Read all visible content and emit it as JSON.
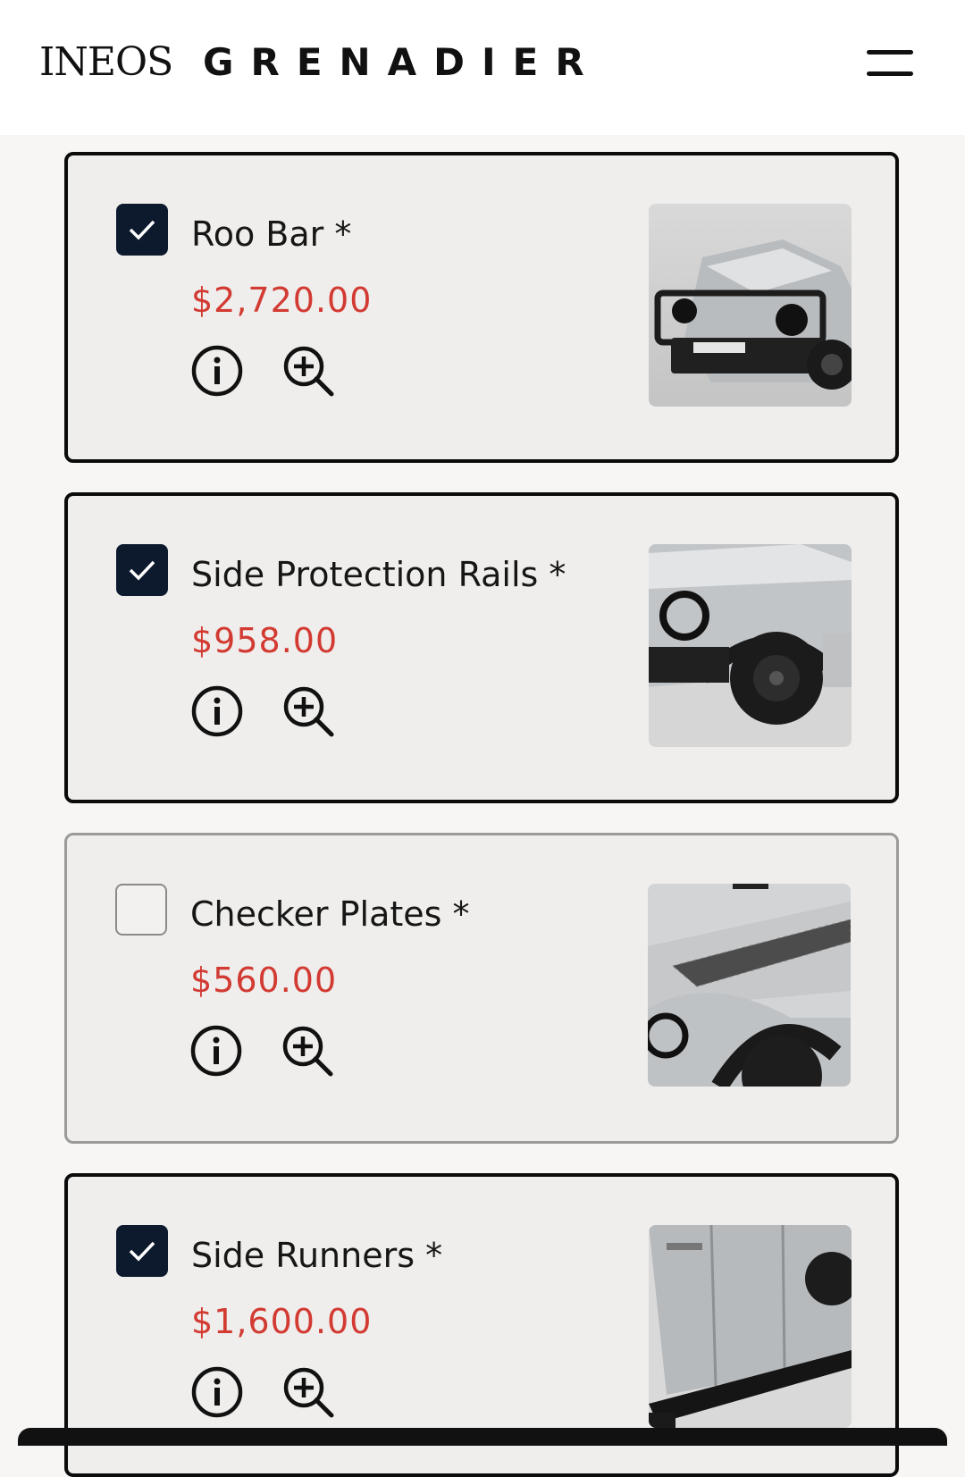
{
  "brand": {
    "name_left": "INEOS",
    "name_right": "GRENADIER"
  },
  "menu": {
    "icon": "hamburger-icon"
  },
  "accessories": [
    {
      "name": "Roo Bar *",
      "price": "$2,720.00",
      "checked": true,
      "image_alt": "Grenadier front with roo bar"
    },
    {
      "name": "Side Protection Rails *",
      "price": "$958.00",
      "checked": true,
      "image_alt": "Grenadier side with protection rails"
    },
    {
      "name": "Checker Plates *",
      "price": "$560.00",
      "checked": false,
      "image_alt": "Grenadier bonnet with checker plates"
    },
    {
      "name": "Side Runners *",
      "price": "$1,600.00",
      "checked": true,
      "image_alt": "Grenadier side runners"
    }
  ],
  "icons": {
    "info": "info-icon",
    "zoom": "zoom-in-icon",
    "check": "checkmark-icon"
  },
  "colors": {
    "price": "#d23a32",
    "checkbox_checked": "#0d1a2e",
    "card_bg": "#efeeec"
  }
}
